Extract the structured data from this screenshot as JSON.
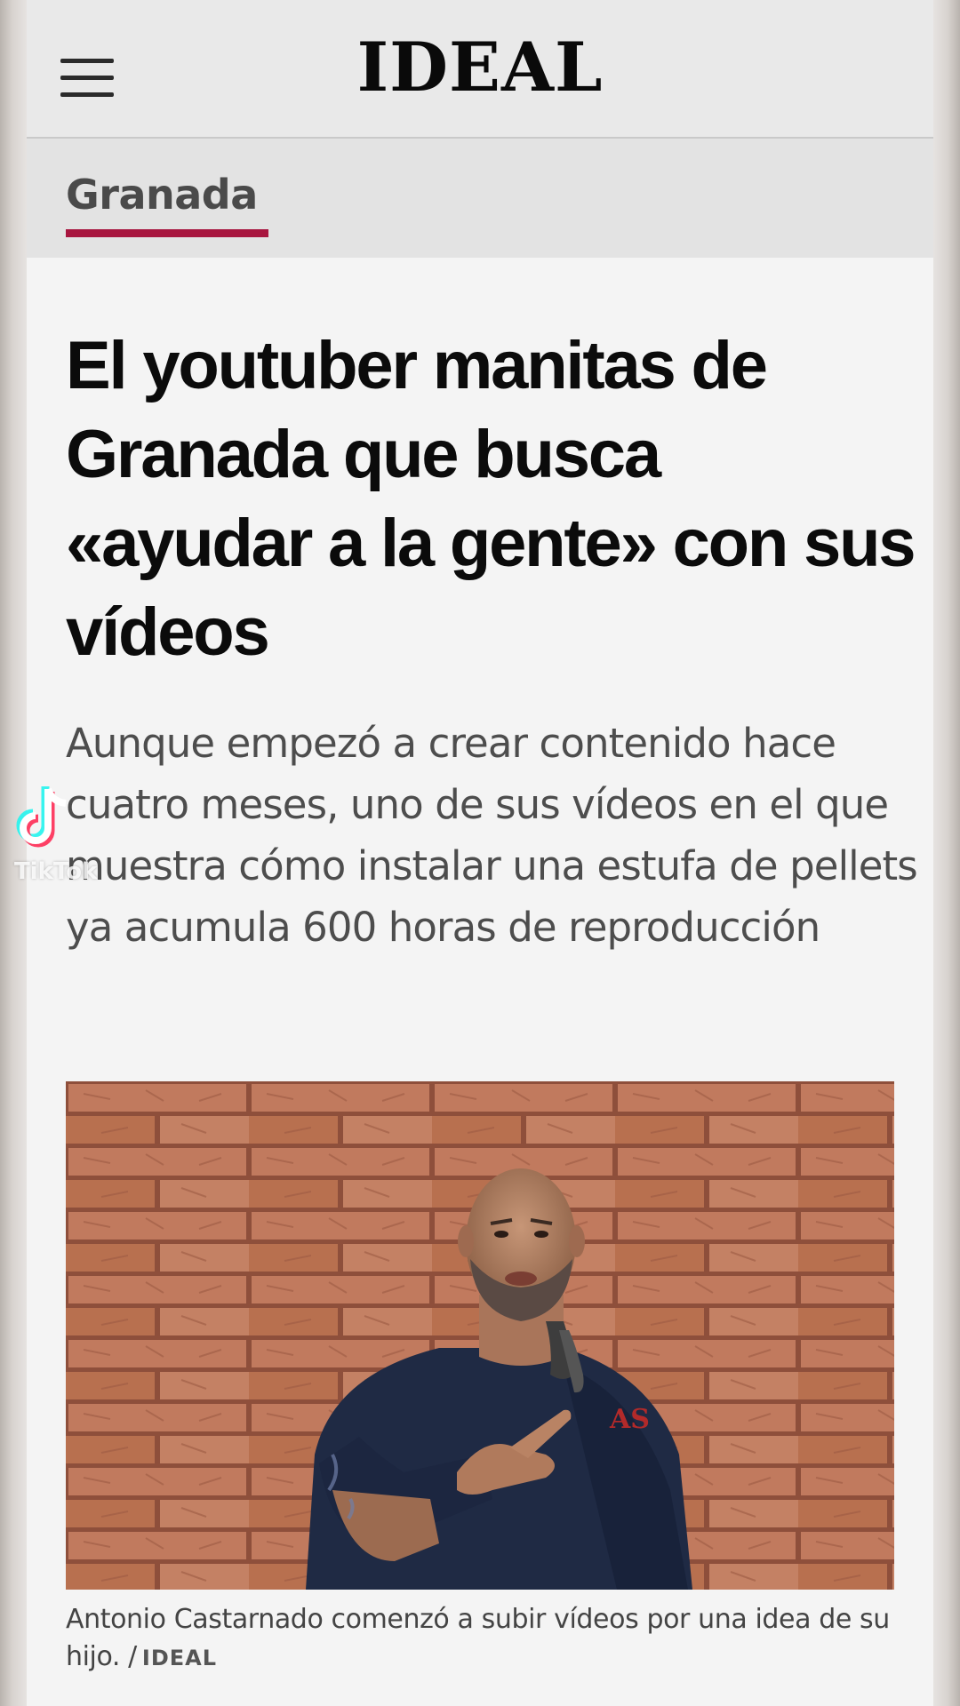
{
  "header": {
    "logo": "IDEAL",
    "menu_icon": "hamburger-menu-icon"
  },
  "section": {
    "label": "Granada",
    "accent_color": "#a8163f"
  },
  "article": {
    "headline": "El youtuber manitas de Granada que busca «ayudar a la gente» con sus vídeos",
    "summary": "Aunque empezó a crear contenido hace cuatro meses, uno de sus vídeos en el que muestra cómo instalar una estufa de pellets ya acumula 600 horas de reproducción",
    "image_icon": "man-in-front-of-brick-wall-photo",
    "caption_text": "Antonio Castarnado comenzó a subir vídeos por una idea de su hijo. /",
    "caption_credit": "IDEAL"
  },
  "watermark": {
    "icon": "tiktok-logo-icon",
    "text": "TikTok"
  }
}
